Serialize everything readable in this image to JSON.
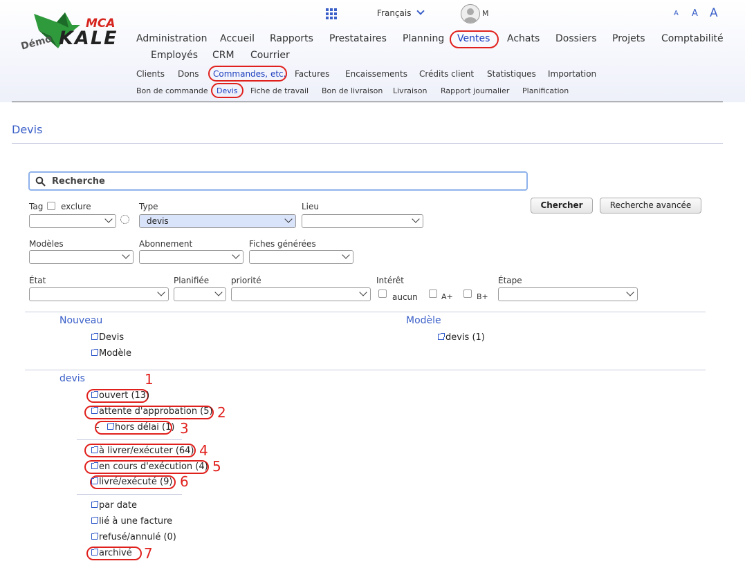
{
  "logo": {
    "demo_text": "Démo",
    "brand_small": "MCA",
    "brand_big": "KALE"
  },
  "top": {
    "language": "Français",
    "user": "M",
    "font_sizes": [
      "A",
      "A",
      "A"
    ]
  },
  "nav_main": [
    "Administration",
    "Accueil",
    "Rapports",
    "Prestataires",
    "Planning",
    "Ventes",
    "Achats",
    "Dossiers",
    "Projets",
    "Comptabilité",
    "Employés",
    "CRM",
    "Courrier"
  ],
  "nav_sub": [
    "Clients",
    "Dons",
    "Commandes, etc.",
    "Factures",
    "Encaissements",
    "Crédits client",
    "Statistiques",
    "Importation"
  ],
  "nav_sub2": [
    "Bon de commande",
    "Devis",
    "Fiche de travail",
    "Bon de livraison",
    "Livraison",
    "Rapport journalier",
    "Planification"
  ],
  "page_title": "Devis",
  "search": {
    "placeholder": "Recherche"
  },
  "filters": {
    "tag": "Tag",
    "exclure": "exclure",
    "type": "Type",
    "type_value": "devis",
    "lieu": "Lieu",
    "modeles": "Modèles",
    "abonnement": "Abonnement",
    "fiches": "Fiches générées",
    "etat": "État",
    "planifiee": "Planifiée",
    "priorite": "priorité",
    "interet": "Intérêt",
    "aucun": "aucun",
    "aplus": "A+",
    "bplus": "B+",
    "etape": "Étape"
  },
  "buttons": {
    "chercher": "Chercher",
    "avancee": "Recherche avancée"
  },
  "nouveau": {
    "title": "Nouveau",
    "items": [
      "Devis",
      "Modèle"
    ]
  },
  "modele": {
    "title": "Modèle",
    "items": [
      "devis (1)"
    ]
  },
  "devis": {
    "title": "devis",
    "items": [
      "ouvert (13)",
      "attente d'approbation (5)",
      "hors délai (1)",
      "à livrer/exécuter (64)",
      "en cours d'exécution (4)",
      "livré/exécuté (9)",
      "par date",
      "lié à une facture",
      "refusé/annulé (0)",
      "archivé"
    ],
    "dash": "–"
  },
  "annotations": [
    "1",
    "2",
    "3",
    "4",
    "5",
    "6",
    "7"
  ],
  "colors": {
    "accent": "#3a5fc8",
    "annotation": "#e0201c",
    "nav_highlight": "#1b3fbf"
  }
}
